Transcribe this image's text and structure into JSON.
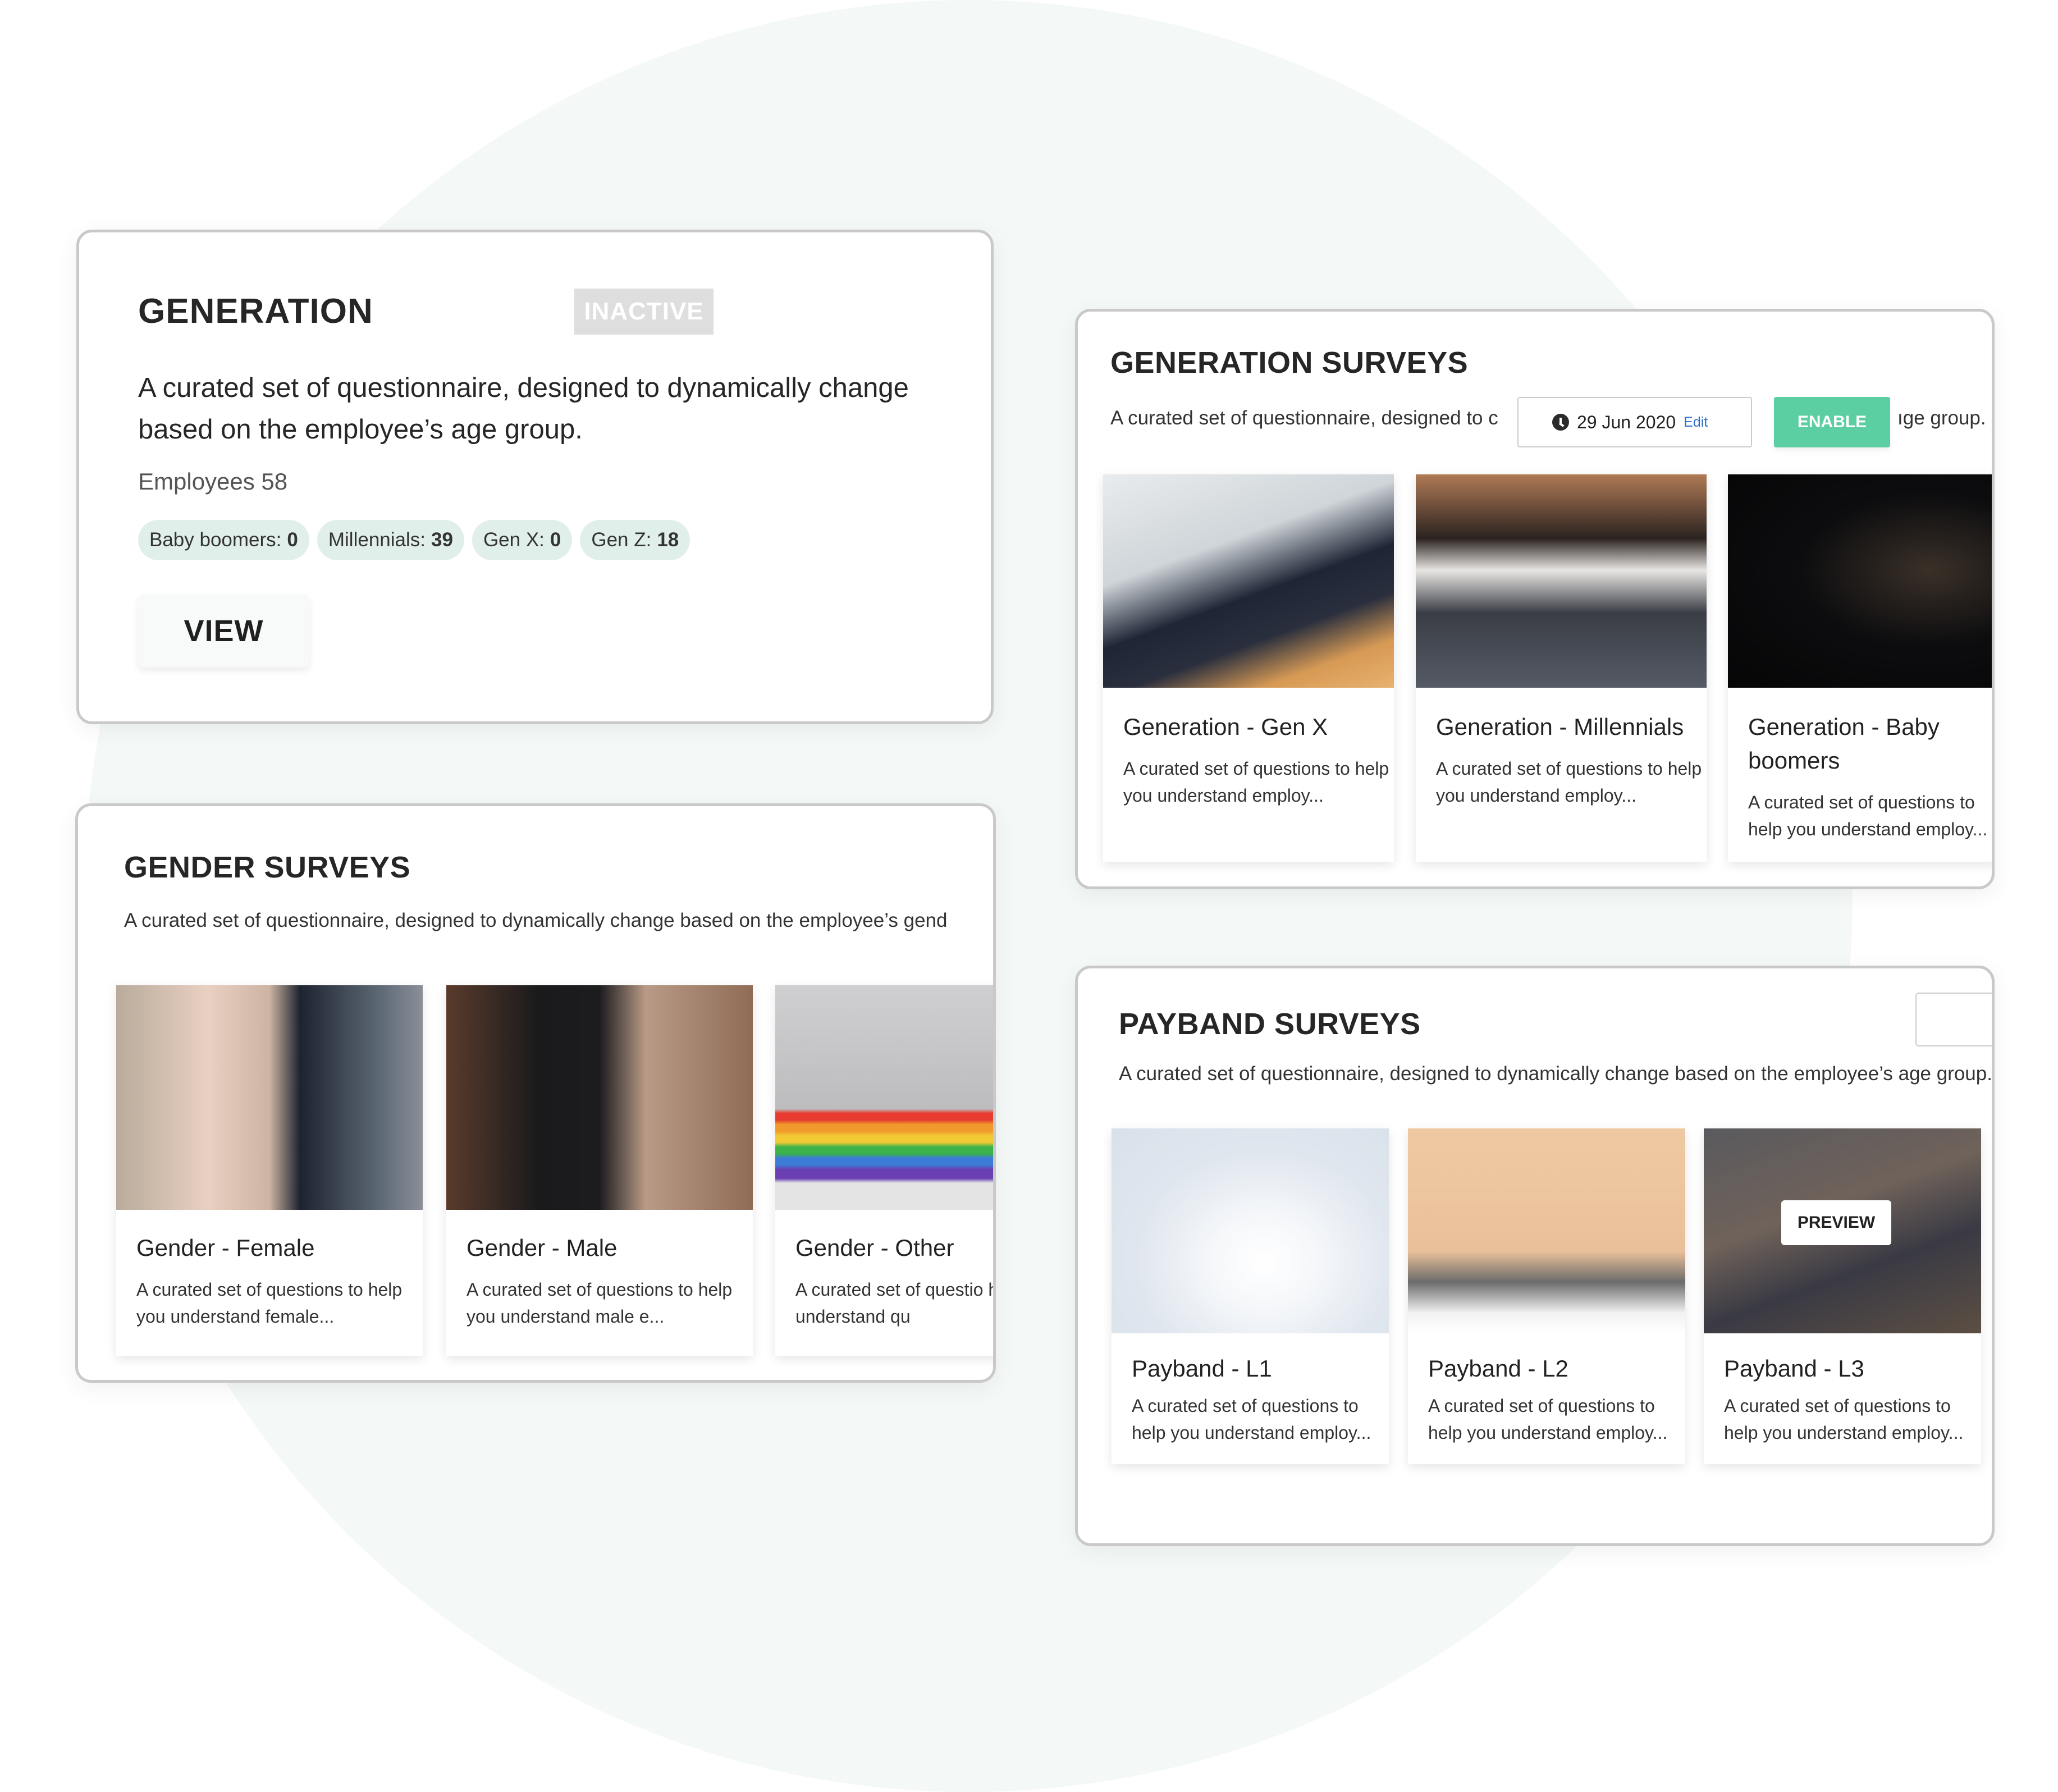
{
  "generation_card": {
    "title": "GENERATION",
    "status_badge": "INACTIVE",
    "description": "A curated set of questionnaire, designed to dynamically change based on the employee’s age group.",
    "employees_label": "Employees 58",
    "tags": [
      {
        "label": "Baby boomers:",
        "value": "0"
      },
      {
        "label": "Millennials:",
        "value": "39"
      },
      {
        "label": "Gen X:",
        "value": "0"
      },
      {
        "label": "Gen Z:",
        "value": "18"
      }
    ],
    "view_button": "VIEW"
  },
  "generation_surveys": {
    "title": "GENERATION SURVEYS",
    "description_start": "A curated set of questionnaire, designed to c",
    "description_end": "ıge group.",
    "date": "29 Jun 2020",
    "edit_label": "Edit",
    "enable_button": "ENABLE",
    "cards": [
      {
        "title": "Generation - Gen X",
        "description": "A curated set of questions to help you understand employ...",
        "image": "man-drinking-coffee-at-laptop"
      },
      {
        "title": "Generation - Millennials",
        "description": "A curated set of questions to help you understand employ...",
        "image": "team-meeting-at-table"
      },
      {
        "title": "Generation - Baby boomers",
        "description": "A curated set of questions to help you understand employ...",
        "image": "two-men-in-suits-dark-room"
      }
    ]
  },
  "gender_surveys": {
    "title": "GENDER SURVEYS",
    "description": "A curated set of questionnaire, designed to dynamically change based on the employee’s gend",
    "cards": [
      {
        "title": "Gender - Female",
        "description": "A curated set of questions to help you understand female...",
        "image": "woman-with-glasses-laptop"
      },
      {
        "title": "Gender - Male",
        "description": "A curated set of questions to help you understand male e...",
        "image": "man-in-suit-alley"
      },
      {
        "title": "Gender - Other",
        "description": "A curated set of questio help you understand qu",
        "image": "person-rainbow-sweater"
      }
    ]
  },
  "payband_surveys": {
    "title": "PAYBAND SURVEYS",
    "description": "A curated set of questionnaire, designed to dynamically change based on the employee’s age group.",
    "preview_button": "PREVIEW",
    "cards": [
      {
        "title": "Payband - L1",
        "description": "A curated set of questions to help you understand employ...",
        "image": "man-adjusting-tie"
      },
      {
        "title": "Payband - L2",
        "description": "A curated set of questions to help you understand employ...",
        "image": "team-around-laptop"
      },
      {
        "title": "Payband - L3",
        "description": "A curated set of questions to help you understand employ...",
        "image": "office-meeting-dimmed"
      }
    ]
  },
  "colors": {
    "accent_green": "#5ccfa2",
    "tag_bg": "#e1efeb",
    "edit_link": "#2a6fc9",
    "inactive_badge": "#dedede"
  }
}
